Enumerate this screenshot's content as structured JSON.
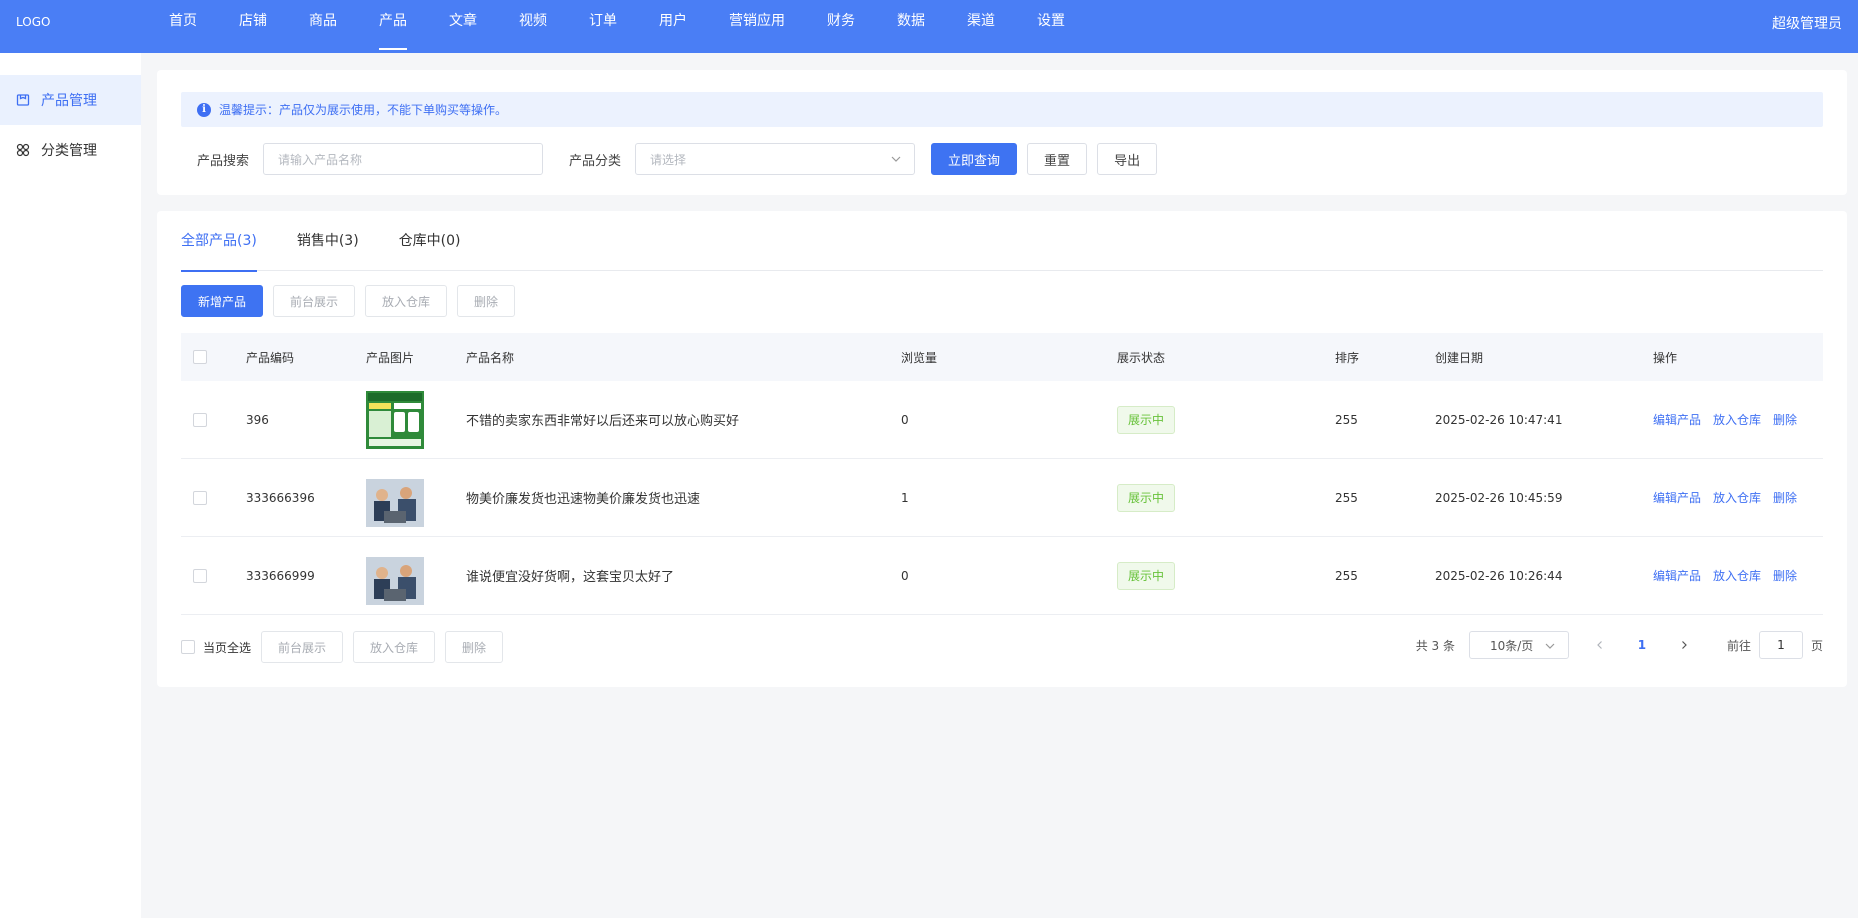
{
  "header": {
    "logo": "LOGO",
    "nav": [
      "首页",
      "店铺",
      "商品",
      "产品",
      "文章",
      "视频",
      "订单",
      "用户",
      "营销应用",
      "财务",
      "数据",
      "渠道",
      "设置"
    ],
    "active_nav": "产品",
    "user": "超级管理员"
  },
  "sidebar": {
    "items": [
      {
        "label": "产品管理",
        "icon": "box-icon"
      },
      {
        "label": "分类管理",
        "icon": "grid-icon"
      }
    ]
  },
  "search": {
    "notice": "温馨提示：产品仅为展示使用，不能下单购买等操作。",
    "keyword_label": "产品搜索",
    "keyword_placeholder": "请输入产品名称",
    "category_label": "产品分类",
    "category_placeholder": "请选择",
    "query_btn": "立即查询",
    "reset_btn": "重置",
    "export_btn": "导出"
  },
  "tabs": [
    "全部产品(3)",
    "销售中(3)",
    "仓库中(0)"
  ],
  "actions": {
    "add": "新增产品",
    "show": "前台展示",
    "store": "放入仓库",
    "delete": "删除"
  },
  "table": {
    "headers": [
      "产品编码",
      "产品图片",
      "产品名称",
      "浏览量",
      "展示状态",
      "排序",
      "创建日期",
      "操作"
    ],
    "rows": [
      {
        "code": "396",
        "name": "不错的卖家东西非常好以后还来可以放心购买好",
        "views": "0",
        "status": "展示中",
        "sort": "255",
        "date": "2025-02-26 10:47:41",
        "thumb": "green-poster"
      },
      {
        "code": "333666396",
        "name": "物美价廉发货也迅速物美价廉发货也迅速",
        "views": "1",
        "status": "展示中",
        "sort": "255",
        "date": "2025-02-26 10:45:59",
        "thumb": "office-photo"
      },
      {
        "code": "333666999",
        "name": "谁说便宜没好货啊，这套宝贝太好了",
        "views": "0",
        "status": "展示中",
        "sort": "255",
        "date": "2025-02-26 10:26:44",
        "thumb": "office-photo"
      }
    ],
    "ops": [
      "编辑产品",
      "放入仓库",
      "删除"
    ]
  },
  "footer": {
    "select_all": "当页全选",
    "total": "共 3 条",
    "page_size": "10条/页",
    "current_page": "1",
    "goto_label": "前往",
    "goto_value": "1",
    "page_unit": "页"
  },
  "colors": {
    "primary": "#3e73f2",
    "header": "#4a7ef5",
    "success": "#67c23a"
  }
}
